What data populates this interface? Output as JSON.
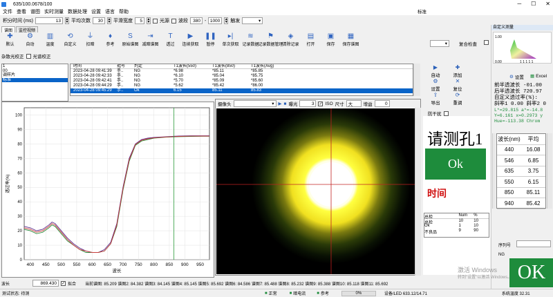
{
  "window": {
    "title": "635/100.0678/100",
    "btn_min": "─",
    "btn_max": "☐",
    "btn_close": "✕"
  },
  "menu": [
    "文件",
    "查看",
    "谱图",
    "实时测量",
    "数据处理",
    "设置",
    "语言",
    "帮助"
  ],
  "params": {
    "integ_label": "积分时间 (ms)",
    "integ_val": "13",
    "avg_label": "平均次数",
    "avg_val": "30",
    "smooth_label": "平滑宽度",
    "smooth_val": "5",
    "source_label": "光源",
    "band_label": "波段",
    "band_from": "380",
    "band_to": "1000",
    "trigger_label": "触发"
  },
  "tabs": [
    "谱图",
    "监控视频"
  ],
  "toolbar": [
    {
      "icon": "✚",
      "label": "默认"
    },
    {
      "icon": "⚙",
      "label": "自动"
    },
    {
      "icon": "▥",
      "label": "温度"
    },
    {
      "icon": "⟲",
      "label": "自定义"
    },
    {
      "icon": "⏚",
      "label": "扣暗"
    },
    {
      "icon": "♦",
      "label": "参考"
    },
    {
      "icon": "S",
      "label": "原始谱图"
    },
    {
      "icon": "⇥",
      "label": "减暗谱图"
    },
    {
      "icon": "T",
      "label": "透过"
    },
    {
      "icon": "▶",
      "label": "连续获取"
    },
    {
      "icon": "❚❚",
      "label": "暂停"
    },
    {
      "icon": "▸|",
      "label": "单次获取"
    },
    {
      "icon": "≋",
      "label": "记录数据"
    },
    {
      "icon": "⚑",
      "label": "记录数据管理"
    },
    {
      "icon": "◈",
      "label": "清除记录"
    },
    {
      "icon": "▤",
      "label": "打开"
    },
    {
      "icon": "▣",
      "label": "保存"
    },
    {
      "icon": "▦",
      "label": "保存谱图"
    },
    {
      "icon": "",
      "label": "标准"
    },
    {
      "icon": "",
      "label": "复合检查"
    }
  ],
  "options": {
    "dark_corr": "杂散光校正",
    "light_corr": "光谱校正"
  },
  "list_items": [
    "1",
    "00",
    "调样片",
    "标准"
  ],
  "table": {
    "headers": [
      "",
      "时间",
      "批号",
      "判定",
      "T1波长(550)",
      "T1波长(850)",
      "T1波长(Avg)"
    ],
    "rows": [
      [
        "",
        "2023-04-28 09:41:39",
        "手..",
        "NG",
        "*6.98",
        "*85.11",
        "*85.85"
      ],
      [
        "",
        "2023-04-28 09:42:33",
        "手..",
        "NG",
        "*6.10",
        "*85.04",
        "*85.75"
      ],
      [
        "",
        "2023-04-28 09:42:41",
        "手..",
        "NG",
        "*5.70",
        "*85.09",
        "*85.60"
      ],
      [
        "",
        "2023-04-28 09:44:29",
        "手..",
        "NG",
        "*5.62",
        "*85.42",
        "*86.00"
      ],
      [
        "",
        "2023-04-28 09:45:29",
        "手..",
        "Ok",
        "6.15",
        "85.11",
        "85.83"
      ]
    ]
  },
  "side_actions": [
    "自动",
    "添加",
    "设置",
    "复位",
    "导出",
    "重调"
  ],
  "anti_shake": "防干扰",
  "chart_data": {
    "type": "line",
    "xlabel": "波长",
    "ylabel": "透过率(%)",
    "xlim": [
      380,
      980
    ],
    "ylim": [
      0,
      105
    ],
    "xticks": [
      400,
      450,
      500,
      550,
      600,
      650,
      700,
      750,
      800,
      850,
      900,
      950
    ],
    "yticks": [
      0,
      10,
      20,
      30,
      40,
      50,
      60,
      70,
      80,
      90,
      100
    ],
    "marker_x": 865,
    "series": [
      {
        "color": "#5a2a8a",
        "x": [
          380,
          400,
          420,
          440,
          460,
          470,
          480,
          500,
          520,
          540,
          560,
          580,
          600,
          620,
          640,
          660,
          680,
          700,
          720,
          740,
          760,
          780,
          800,
          840,
          880,
          920,
          960,
          980
        ],
        "y": [
          23,
          22,
          20,
          21,
          24,
          26,
          25,
          20,
          15,
          11,
          8,
          6,
          5,
          5,
          7,
          12,
          25,
          50,
          70,
          80,
          83,
          84,
          84.5,
          85,
          85.5,
          85.6,
          85.6,
          85.6
        ]
      },
      {
        "color": "#2b8a3a",
        "x": [
          380,
          400,
          420,
          440,
          460,
          470,
          480,
          500,
          520,
          540,
          560,
          580,
          600,
          620,
          640,
          660,
          680,
          700,
          720,
          740,
          760,
          780,
          800,
          840,
          880,
          920,
          960,
          980
        ],
        "y": [
          21,
          20,
          18,
          19,
          22,
          24,
          23,
          18,
          13,
          10,
          7,
          5,
          5,
          5,
          6,
          11,
          23,
          48,
          68,
          79,
          82,
          83,
          84,
          84.7,
          85,
          85.2,
          85.3,
          85.3
        ]
      },
      {
        "color": "#c83a3a",
        "x": [
          380,
          400,
          420,
          440,
          460,
          470,
          480,
          500,
          520,
          540,
          560,
          580,
          600,
          620,
          640,
          660,
          680,
          700,
          720,
          740,
          760,
          780,
          800,
          840,
          880,
          920,
          960,
          980
        ],
        "y": [
          22,
          21,
          19,
          20,
          23,
          25,
          24,
          19,
          14,
          10,
          7,
          6,
          5,
          5,
          6,
          11,
          24,
          49,
          69,
          79.5,
          82.5,
          83.5,
          84.2,
          84.8,
          85.2,
          85.4,
          85.5,
          85.4
        ]
      }
    ]
  },
  "camera": {
    "label": "摄像头",
    "exposure_label": "曝光",
    "exposure_val": "3",
    "iso_label": "ISO",
    "size_label": "尺寸",
    "size_val": "大",
    "gain_label": "增益",
    "gain_val": "0"
  },
  "prompt": {
    "text": "请测孔1",
    "result": "Ok",
    "time_label": "时间"
  },
  "stats": {
    "headers": [
      "总检",
      "Num",
      "%"
    ],
    "rows": [
      [
        "总检",
        "10",
        "10"
      ],
      [
        "Ok",
        "1",
        "10"
      ],
      [
        "不良品",
        "9",
        "90"
      ]
    ]
  },
  "bottom": {
    "wl_label": "波长",
    "wl_val": "869.430",
    "fit_label": "拟合",
    "readout": "当前谱图: 85.209 谱图2: 84.382 谱图3: 84.145 谱图4: 85.145 谱图5: 85.692 谱图6: 84.586 谱图7: 85.488 谱图8: 85.232 谱图9: 85.388 谱图10: 85.118 谱图11: 85.692"
  },
  "status": {
    "left": "测试状态: 待测",
    "s1": "正常",
    "s2": "暗电流",
    "s3": "参考",
    "s4": "0%",
    "device": "设备/LED 633.12/14.71",
    "temp": "系统温度 32.31"
  },
  "right": {
    "title": "自定义测量",
    "set_label": "设置",
    "excel_label": "Excel",
    "lines": [
      "前半透波长 -01.00",
      "后半透波长 720.97",
      "自定义透过率(%):",
      "斜率1 0.00  斜率2 0",
      "L*=29.815 a*=-14.8",
      "Y=6.161 x=0.2973 y",
      "Hue=-113.38 Chrom"
    ],
    "tbl_head": [
      "波长(nm)",
      "平均"
    ],
    "tbl_rows": [
      [
        "440",
        "16.08"
      ],
      [
        "546",
        "6.85"
      ],
      [
        "635",
        "3.75"
      ],
      [
        "550",
        "6.15"
      ],
      [
        "850",
        "85.11"
      ],
      [
        "940",
        "85.42"
      ]
    ],
    "serial_label": "序列号",
    "ng_label": "NG",
    "big_ok": "OK",
    "watermark1": "激活 Windows",
    "watermark2": "转到\"设置\"以激活 Windows。"
  },
  "colors": {
    "accent": "#0a64c8",
    "ok_green": "#1e8c3c",
    "red": "#d01010"
  }
}
